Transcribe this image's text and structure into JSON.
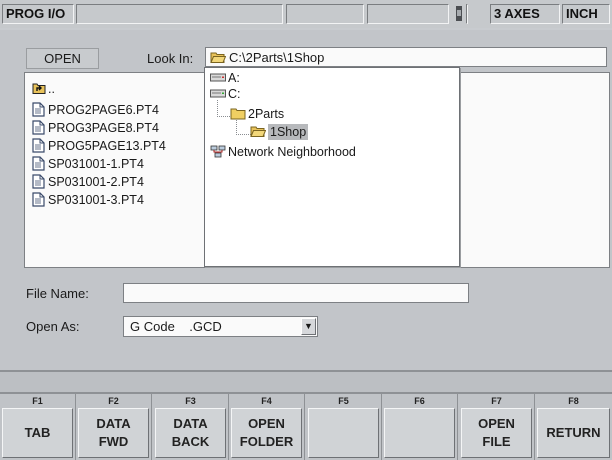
{
  "status": {
    "mode": "PROG I/O",
    "axes": "3 AXES",
    "units": "INCH"
  },
  "dialog": {
    "open_label": "OPEN",
    "look_in_label": "Look In:",
    "look_in_path": "C:\\2Parts\\1Shop",
    "files": [
      {
        "name": "..",
        "icon": "parent-folder-icon"
      },
      {
        "name": "PROG2PAGE6.PT4",
        "icon": "file-icon"
      },
      {
        "name": "PROG3PAGE8.PT4",
        "icon": "file-icon"
      },
      {
        "name": "PROG5PAGE13.PT4",
        "icon": "file-icon"
      },
      {
        "name": "SP031001-1.PT4",
        "icon": "file-icon"
      },
      {
        "name": "SP031001-2.PT4",
        "icon": "file-icon"
      },
      {
        "name": "SP031001-3.PT4",
        "icon": "file-icon"
      }
    ],
    "tree": [
      {
        "label": "A:",
        "icon": "drive-icon"
      },
      {
        "label": "C:",
        "icon": "drive-icon"
      },
      {
        "label": "2Parts",
        "icon": "folder-icon"
      },
      {
        "label": "1Shop",
        "icon": "open-folder-icon",
        "selected": true
      },
      {
        "label": "Network Neighborhood",
        "icon": "network-icon"
      }
    ],
    "file_name_label": "File Name:",
    "file_name_value": "",
    "open_as_label": "Open As:",
    "open_as_value": "G Code    .GCD"
  },
  "softkeys": [
    {
      "key": "F1",
      "label": "TAB"
    },
    {
      "key": "F2",
      "label": "DATA\nFWD"
    },
    {
      "key": "F3",
      "label": "DATA\nBACK"
    },
    {
      "key": "F4",
      "label": "OPEN\nFOLDER"
    },
    {
      "key": "F5",
      "label": ""
    },
    {
      "key": "F6",
      "label": ""
    },
    {
      "key": "F7",
      "label": "OPEN\nFILE"
    },
    {
      "key": "F8",
      "label": "RETURN"
    }
  ]
}
